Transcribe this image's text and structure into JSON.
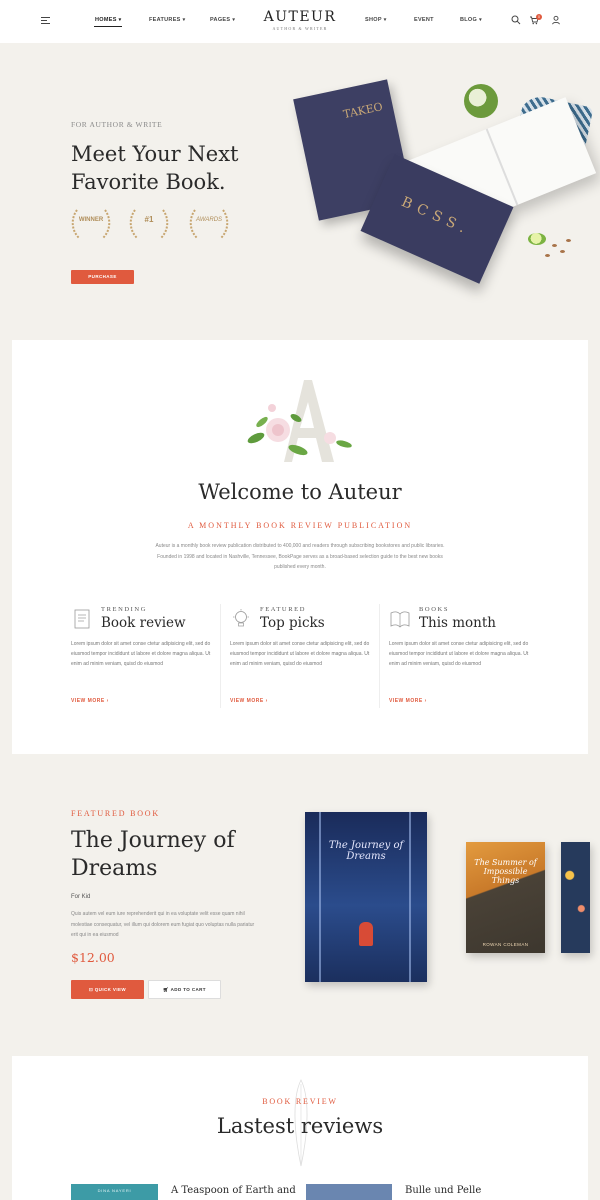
{
  "header": {
    "logo": "AUTEUR",
    "logo_sub": "AUTHOR & WRITER",
    "nav": [
      {
        "label": "HOMES",
        "caret": "▾"
      },
      {
        "label": "FEATURES",
        "caret": "▾"
      },
      {
        "label": "PAGES",
        "caret": "▾"
      },
      {
        "label": "SHOP",
        "caret": "▾"
      },
      {
        "label": "EVENT",
        "caret": ""
      },
      {
        "label": "BLOG",
        "caret": "▾"
      }
    ],
    "cart_count": "0",
    "icons": [
      "menu-icon",
      "search-icon",
      "cart-icon",
      "user-icon"
    ]
  },
  "hero": {
    "kicker": "FOR AUTHOR & WRITE",
    "title": "Meet Your Next Favorite Book.",
    "awards": [
      {
        "small": "",
        "main": "WINNER"
      },
      {
        "small": "",
        "main": "#1"
      },
      {
        "small": "",
        "main": "AWARDS"
      }
    ],
    "button": "PURCHASE",
    "book_letters_1": "TAKEO",
    "book_letters_2": "BCSS."
  },
  "welcome": {
    "title": "Welcome to Auteur",
    "subtitle": "A MONTHLY BOOK REVIEW PUBLICATION",
    "body": "Auteur is a monthly book review publication distributed to 400,000 and readers through subscribing bookstores and public libraries. Founded in 1998 and located in Nashville, Tennessee, BookPage serves as a broad-based selection guide to the best new books published every month.",
    "features": [
      {
        "kicker": "TRENDING",
        "title": "Book review",
        "body": "Lorem ipsum dolor sit amet conse ctetur adipisicing elit, sed do eiusmod tempor incididunt ut labore et dolore magna aliqua. Ut enim ad minim veniam, quisd do eiusmod",
        "link": "VIEW MORE"
      },
      {
        "kicker": "FEATURED",
        "title": "Top picks",
        "body": "Lorem ipsum dolor sit amet conse ctetur adipisicing elit, sed do eiusmod tempor incididunt ut labore et dolore magna aliqua. Ut enim ad minim veniam, quisd do eiusmod",
        "link": "VIEW MORE"
      },
      {
        "kicker": "BOOKS",
        "title": "This month",
        "body": "Lorem ipsum dolor sit amet conse ctetur adipisicing elit, sed do eiusmod tempor incididunt ut labore et dolore magna aliqua. Ut enim ad minim veniam, quisd do eiusmod",
        "link": "VIEW MORE"
      }
    ]
  },
  "featured_book": {
    "kicker": "FEATURED BOOK",
    "title": "The Journey of Dreams",
    "for": "For Kid",
    "description": "Quis autem vel eum iure reprehenderit qui in ea voluptate velit esse quam nihil molestiae consequatur, vel illum qui dolorem eum fugiat quo voluptas nulla pariatur erit qui in ea eiusmod",
    "price": "$12.00",
    "quick_view": "QUICK VIEW",
    "add_to_cart": "ADD TO CART",
    "cover_title": "The Journey of Dreams",
    "cover2_title": "The Summer of Impossible Things",
    "cover2_author": "ROWAN COLEMAN"
  },
  "reviews": {
    "kicker": "BOOK REVIEW",
    "title": "Lastest reviews",
    "items": [
      {
        "cover_text": "DINA NAYERI",
        "title": "A Teaspoon of Earth and"
      },
      {
        "cover_text": "",
        "title": "Bulle und Pelle"
      }
    ]
  },
  "colors": {
    "accent": "#e05a3e",
    "background": "#f3f1ec",
    "card": "#ffffff",
    "text": "#2a2a2a"
  }
}
